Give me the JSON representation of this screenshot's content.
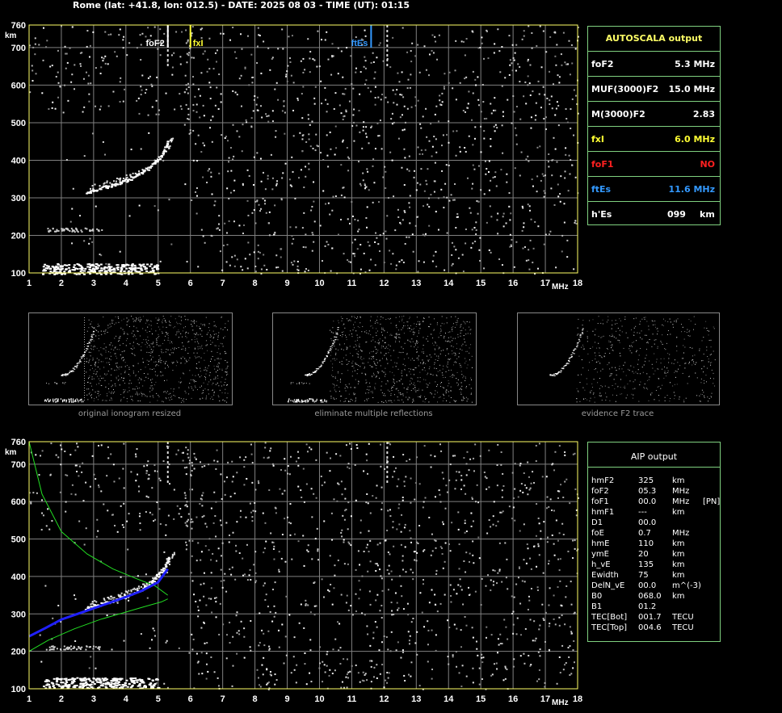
{
  "header": {
    "title": "Rome (lat: +41.8, lon: 012.5) - DATE: 2025 08 03 - TIME (UT): 01:15"
  },
  "colors": {
    "frame": "#ffff66",
    "grid": "#808080",
    "panel_border": "#7fd07f",
    "foF2": "#ffffff",
    "fxI": "#ffff33",
    "foF1": "#ff2020",
    "ftEs": "#3399ff",
    "profile": "#2020ff",
    "model": "#22dd22"
  },
  "chart_data": [
    {
      "type": "scatter",
      "title": "",
      "xlabel": "MHz",
      "ylabel": "km",
      "xlim": [
        1,
        18
      ],
      "ylim": [
        100,
        760
      ],
      "x_ticks": [
        "1",
        "2",
        "3",
        "4",
        "5",
        "6",
        "7",
        "8",
        "9",
        "10",
        "11",
        "12",
        "13",
        "14",
        "15",
        "16",
        "17",
        "18"
      ],
      "y_ticks": [
        "100",
        "200",
        "300",
        "400",
        "500",
        "600",
        "700",
        "760"
      ],
      "markers": [
        {
          "label": "foF2",
          "x": 5.3,
          "color": "#ffffff"
        },
        {
          "label": "fxI",
          "x": 6.0,
          "color": "#ffff33"
        },
        {
          "label": "ftEs",
          "x": 11.6,
          "color": "#3399ff"
        }
      ],
      "traces": {
        "f2_trace": [
          [
            2.7,
            316
          ],
          [
            3.2,
            328
          ],
          [
            3.6,
            338
          ],
          [
            4.0,
            350
          ],
          [
            4.4,
            366
          ],
          [
            4.8,
            390
          ],
          [
            5.1,
            420
          ],
          [
            5.3,
            455
          ]
        ],
        "es_layer": {
          "x_from": 1.4,
          "x_to": 5.0,
          "height": 110
        },
        "multiple_reflection": {
          "x_from": 1.5,
          "x_to": 3.3,
          "height": 215
        }
      },
      "grid": true
    },
    {
      "type": "scatter",
      "title": "",
      "xlabel": "MHz",
      "ylabel": "km",
      "xlim": [
        1,
        18
      ],
      "ylim": [
        100,
        760
      ],
      "x_ticks": [
        "1",
        "2",
        "3",
        "4",
        "5",
        "6",
        "7",
        "8",
        "9",
        "10",
        "11",
        "12",
        "13",
        "14",
        "15",
        "16",
        "17",
        "18"
      ],
      "y_ticks": [
        "100",
        "200",
        "300",
        "400",
        "500",
        "600",
        "700",
        "760"
      ],
      "traces": {
        "f2_trace": [
          [
            2.7,
            316
          ],
          [
            3.2,
            328
          ],
          [
            3.6,
            338
          ],
          [
            4.0,
            350
          ],
          [
            4.4,
            366
          ],
          [
            4.8,
            390
          ],
          [
            5.1,
            420
          ],
          [
            5.3,
            455
          ]
        ],
        "es_layer": {
          "x_from": 1.4,
          "x_to": 5.0,
          "height": 115
        },
        "multiple_reflection": {
          "x_from": 1.5,
          "x_to": 3.3,
          "height": 210
        },
        "profile_blue": [
          [
            1.0,
            240
          ],
          [
            1.5,
            262
          ],
          [
            2.0,
            285
          ],
          [
            2.5,
            300
          ],
          [
            3.0,
            315
          ],
          [
            3.5,
            330
          ],
          [
            4.0,
            345
          ],
          [
            4.5,
            362
          ],
          [
            5.0,
            385
          ],
          [
            5.3,
            420
          ]
        ],
        "model_upper_green": [
          [
            1.0,
            760
          ],
          [
            1.4,
            620
          ],
          [
            2.0,
            520
          ],
          [
            2.8,
            460
          ],
          [
            3.6,
            420
          ],
          [
            4.3,
            395
          ],
          [
            4.9,
            375
          ],
          [
            5.3,
            350
          ]
        ],
        "model_lower_green": [
          [
            1.0,
            200
          ],
          [
            1.6,
            230
          ],
          [
            2.4,
            260
          ],
          [
            3.2,
            285
          ],
          [
            4.0,
            305
          ],
          [
            4.6,
            320
          ],
          [
            5.1,
            332
          ],
          [
            5.3,
            340
          ]
        ]
      },
      "grid": true
    }
  ],
  "autoscala": {
    "title": "AUTOSCALA output",
    "rows": [
      {
        "label": "foF2",
        "value": "5.3 MHz",
        "color": "#ffffff"
      },
      {
        "label": "MUF(3000)F2",
        "value": "15.0 MHz",
        "color": "#ffffff"
      },
      {
        "label": "M(3000)F2",
        "value": "2.83",
        "color": "#ffffff"
      },
      {
        "label": "fxI",
        "value": "6.0 MHz",
        "color": "#ffff33"
      },
      {
        "label": "foF1",
        "value": "NO",
        "color": "#ff2020"
      },
      {
        "label": "ftEs",
        "value": "11.6 MHz",
        "color": "#3399ff"
      },
      {
        "label": "h'Es",
        "value": "099",
        "unit": "km",
        "color": "#ffffff"
      }
    ]
  },
  "thumbnails": [
    {
      "caption": "original ionogram resized"
    },
    {
      "caption": "eliminate multiple reflections"
    },
    {
      "caption": "evidence F2 trace"
    }
  ],
  "aip": {
    "title": "AIP output",
    "rows": [
      [
        "hmF2",
        "325",
        "km",
        ""
      ],
      [
        "foF2",
        "05.3",
        "MHz",
        ""
      ],
      [
        "foF1",
        "00.0",
        "MHz",
        "[PN]"
      ],
      [
        "hmF1",
        "---",
        "km",
        ""
      ],
      [
        "D1",
        "00.0",
        "",
        ""
      ],
      [
        "foE",
        "0.7",
        "MHz",
        ""
      ],
      [
        "hmE",
        "110",
        "km",
        ""
      ],
      [
        "ymE",
        "20",
        "km",
        ""
      ],
      [
        "h_vE",
        "135",
        "km",
        ""
      ],
      [
        "Ewidth",
        "75",
        "km",
        ""
      ],
      [
        "DelN_vE",
        "00.0",
        "m^(-3)",
        ""
      ],
      [
        "B0",
        "068.0",
        "km",
        ""
      ],
      [
        "B1",
        "01.2",
        "",
        ""
      ],
      [
        "TEC[Bot]",
        "001.7",
        "TECU",
        ""
      ],
      [
        "TEC[Top]",
        "004.6",
        "TECU",
        ""
      ]
    ]
  }
}
